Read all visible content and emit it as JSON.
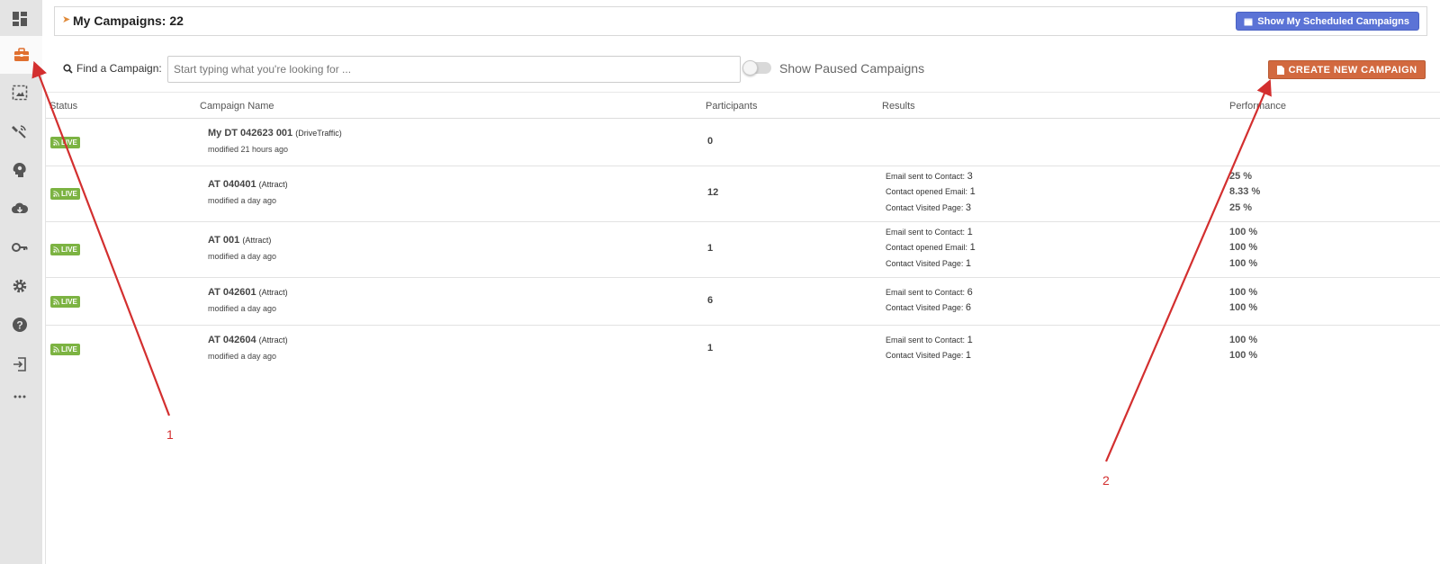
{
  "header": {
    "title": "My Campaigns: 22",
    "scheduled_button": "Show My Scheduled Campaigns"
  },
  "search": {
    "label": "Find a Campaign:",
    "placeholder": "Start typing what you're looking for ..."
  },
  "paused_toggle": {
    "label": "Show Paused Campaigns",
    "on": false
  },
  "create_button": "CREATE NEW CAMPAIGN",
  "columns": [
    "Status",
    "Campaign Name",
    "Participants",
    "Results",
    "Performance"
  ],
  "campaigns": [
    {
      "status": "LIVE",
      "name": "My DT 042623 001",
      "type": "(DriveTraffic)",
      "modified": "modified 21 hours ago",
      "participants": "0",
      "results": [],
      "performance": []
    },
    {
      "status": "LIVE",
      "name": "AT 040401",
      "type": "(Attract)",
      "modified": "modified a day ago",
      "participants": "12",
      "results": [
        {
          "label": "Email sent to Contact:",
          "value": "3"
        },
        {
          "label": "Contact opened Email:",
          "value": "1"
        },
        {
          "label": "Contact Visited Page:",
          "value": "3"
        }
      ],
      "performance": [
        "25 %",
        "8.33 %",
        "25 %"
      ]
    },
    {
      "status": "LIVE",
      "name": "AT 001",
      "type": "(Attract)",
      "modified": "modified a day ago",
      "participants": "1",
      "results": [
        {
          "label": "Email sent to Contact:",
          "value": "1"
        },
        {
          "label": "Contact opened Email:",
          "value": "1"
        },
        {
          "label": "Contact Visited Page:",
          "value": "1"
        }
      ],
      "performance": [
        "100 %",
        "100 %",
        "100 %"
      ]
    },
    {
      "status": "LIVE",
      "name": "AT 042601",
      "type": "(Attract)",
      "modified": "modified a day ago",
      "participants": "6",
      "results": [
        {
          "label": "Email sent to Contact:",
          "value": "6"
        },
        {
          "label": "Contact Visited Page:",
          "value": "6"
        }
      ],
      "performance": [
        "100 %",
        "100 %"
      ]
    },
    {
      "status": "LIVE",
      "name": "AT 042604",
      "type": "(Attract)",
      "modified": "modified a day ago",
      "participants": "1",
      "results": [
        {
          "label": "Email sent to Contact:",
          "value": "1"
        },
        {
          "label": "Contact Visited Page:",
          "value": "1"
        }
      ],
      "performance": [
        "100 %",
        "100 %"
      ]
    }
  ],
  "annotations": [
    "1",
    "2"
  ],
  "colors": {
    "accent_orange": "#d2693f",
    "accent_blue": "#5b73d6",
    "live_green": "#7cb342",
    "annotation_red": "#d32f2f"
  },
  "sidebar_icons": [
    "dashboard-icon",
    "briefcase-icon",
    "image-frame-icon",
    "satellite-icon",
    "brain-icon",
    "cloud-download-icon",
    "key-icon",
    "gear-icon",
    "help-icon",
    "logout-icon",
    "more-icon"
  ]
}
